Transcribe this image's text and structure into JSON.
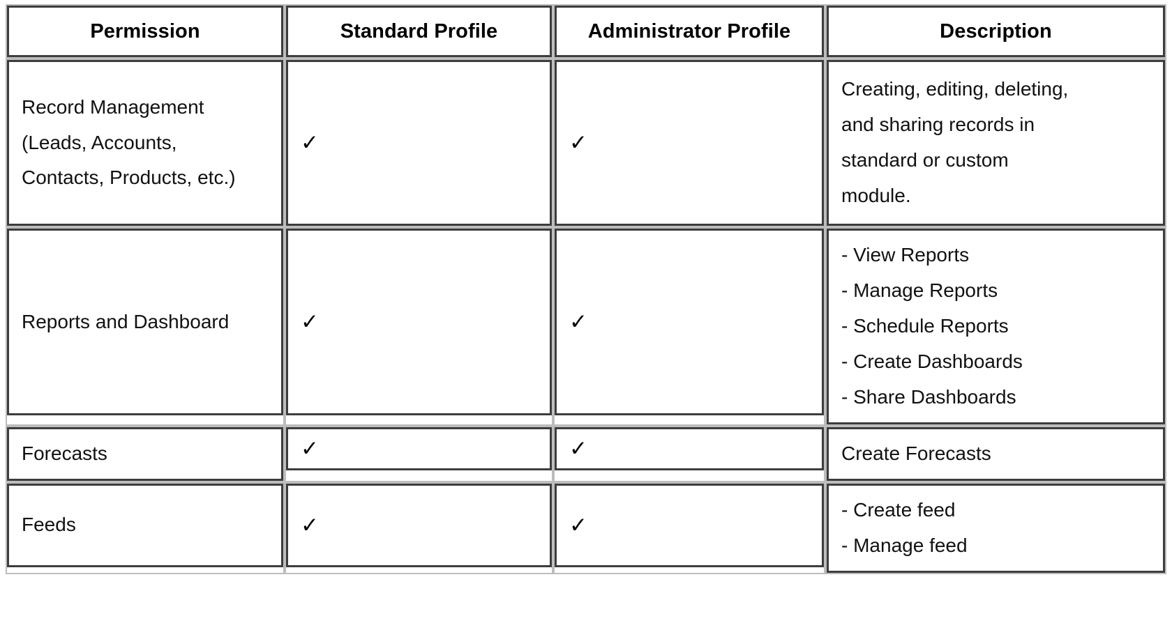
{
  "table": {
    "columns": [
      {
        "key": "permission",
        "label": "Permission"
      },
      {
        "key": "standard",
        "label": "Standard Profile"
      },
      {
        "key": "admin",
        "label": "Administrator Profile"
      },
      {
        "key": "description",
        "label": "Description"
      }
    ],
    "check_glyph": "✓",
    "rows": [
      {
        "permission_lines": [
          "Record Management",
          "(Leads, Accounts,",
          "Contacts, Products, etc.)"
        ],
        "permission": "Record Management (Leads, Accounts, Contacts, Products, etc.)",
        "standard": "✓",
        "admin": "✓",
        "description_lines": [
          "Creating, editing, deleting,",
          "and sharing records in",
          "standard or custom",
          "module."
        ],
        "description": "Creating, editing, deleting, and sharing records in standard or custom module."
      },
      {
        "permission_lines": [
          "Reports and Dashboard"
        ],
        "permission": "Reports and Dashboard",
        "standard": "✓",
        "admin": "✓",
        "description_lines": [
          "- View Reports",
          "- Manage Reports",
          "- Schedule Reports",
          "- Create Dashboards",
          "- Share Dashboards"
        ],
        "description": "- View Reports - Manage Reports - Schedule Reports - Create Dashboards - Share Dashboards"
      },
      {
        "permission_lines": [
          "Forecasts"
        ],
        "permission": "Forecasts",
        "standard": "✓",
        "admin": "✓",
        "description_lines": [
          "Create Forecasts"
        ],
        "description": "Create Forecasts"
      },
      {
        "permission_lines": [
          "Feeds"
        ],
        "permission": "Feeds",
        "standard": "✓",
        "admin": "✓",
        "description_lines": [
          "- Create feed",
          "- Manage feed"
        ],
        "description": "- Create feed - Manage feed"
      }
    ]
  },
  "colors": {
    "cell_border_outer": "#bdbdbd",
    "cell_border_inner": "#3d3d3d",
    "text": "#111111",
    "heading_text": "#000000",
    "background": "#ffffff"
  }
}
